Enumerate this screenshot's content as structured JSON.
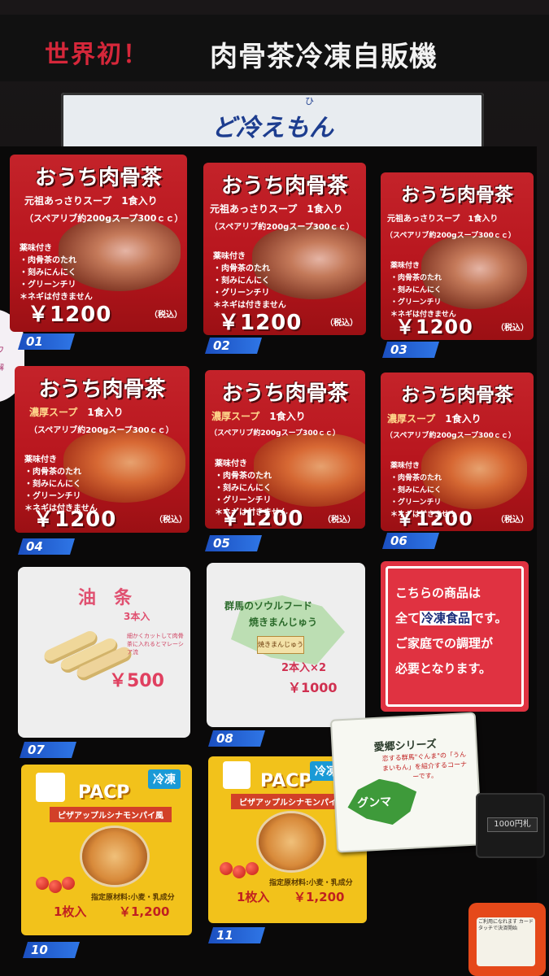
{
  "header": {
    "red_text": "世界初！",
    "white_text": "肉骨茶冷凍自販機"
  },
  "logo": {
    "ruby": "ひ",
    "text": "ど冷えもん"
  },
  "left_sign": {
    "line1": "ワ",
    "line2": "解"
  },
  "bkt": {
    "title": "おうち肉骨茶",
    "light_soup": "元祖あっさりスープ　1食入り",
    "thick_soup_name": "濃厚スープ",
    "thick_qty": "1食入り",
    "spec": "（スペアリブ約200gスープ300ｃｃ）",
    "cond_title": "薬味付き",
    "cond_1": "・肉骨茶のたれ",
    "cond_2": "・刻みにんにく",
    "cond_3": "・グリーンチリ",
    "cond_4": "＊ネギは付きません",
    "price": "￥1200",
    "tax": "（税込）"
  },
  "slot_numbers": [
    "01",
    "02",
    "03",
    "04",
    "05",
    "06",
    "07",
    "08",
    "10",
    "11"
  ],
  "youtiao": {
    "name": "油　条",
    "qty": "3本入",
    "desc": "細かくカットして肉骨茶に入れるとマレーシア流",
    "price": "￥500"
  },
  "manju": {
    "subtitle": "群馬のソウルフード",
    "name": "焼きまんじゅう",
    "pack": "焼きまんじゅう",
    "qty": "2本入×2",
    "price": "￥1000"
  },
  "notice": {
    "line1": "こちらの商品は",
    "line2_pre": "全て",
    "line2_box": "冷凍食品",
    "line2_post": "です。",
    "line3": "ご家庭での調理が",
    "line4": "必要となります。"
  },
  "pacp": {
    "brand": "PACP",
    "badge": "冷凍",
    "subtitle": "ピザアップルシナモンパイ風",
    "ingredients": "指定原材料:小麦・乳成分",
    "qty": "1枚入",
    "price": "￥1,200"
  },
  "aikyo": {
    "title": "愛郷シリーズ",
    "desc": "恋する群馬\"ぐんま\"の「うんまいもん」を紹介するコーナーです。",
    "map_label": "グンマ"
  },
  "bill": {
    "label": "1000円札"
  },
  "reader": {
    "text": "ご利用になれます カードタッチで決済開始"
  }
}
